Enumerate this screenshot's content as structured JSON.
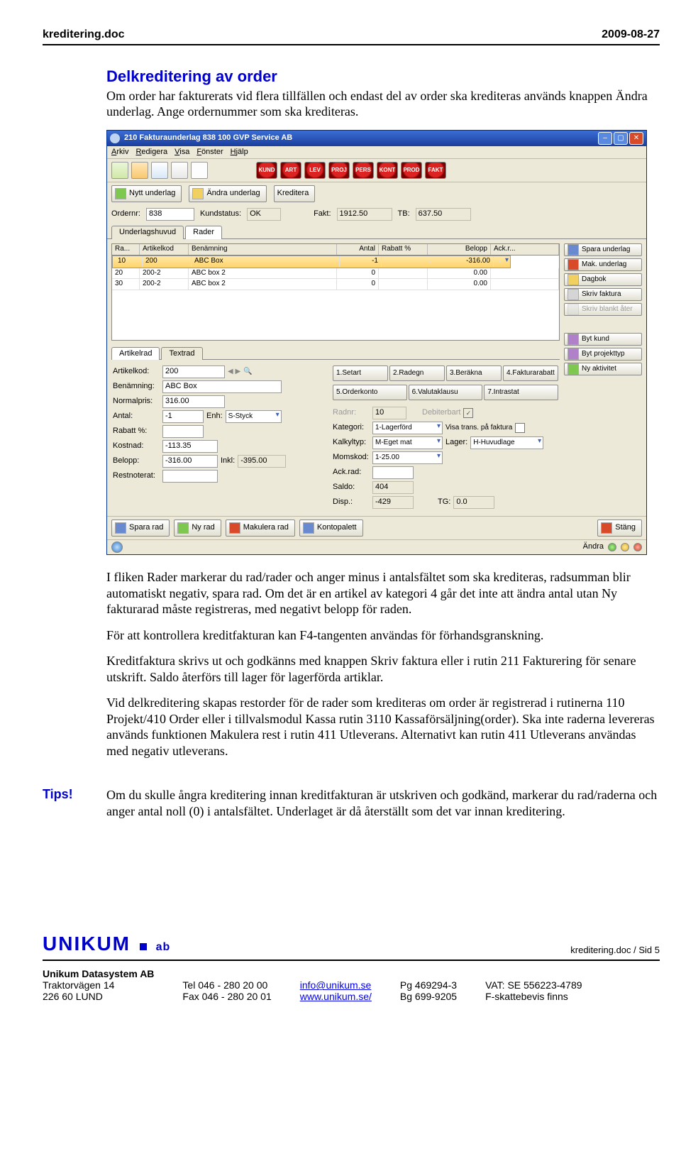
{
  "header": {
    "doc_name": "kreditering.doc",
    "date": "2009-08-27"
  },
  "section": {
    "title": "Delkreditering av order",
    "intro": "Om order har fakturerats vid flera tillfällen och endast del av order ska krediteras används knappen Ändra underlag. Ange ordernummer som ska krediteras."
  },
  "screenshot": {
    "title": "210 Fakturaunderlag 838  100  GVP Service AB",
    "menu": [
      "Arkiv",
      "Redigera",
      "Visa",
      "Fönster",
      "Hjälp"
    ],
    "red_btns": [
      "KUND",
      "ART",
      "LEV",
      "PROJ",
      "PERS",
      "KONT",
      "PROD",
      "FAKT"
    ],
    "btn_row": {
      "nytt": "Nytt underlag",
      "andra": "Ändra underlag",
      "kreditera": "Kreditera"
    },
    "order_row": {
      "ordernr_lbl": "Ordernr:",
      "ordernr_val": "838",
      "kundstatus_lbl": "Kundstatus:",
      "kundstatus_val": "OK",
      "fakt_lbl": "Fakt:",
      "fakt_val": "1912.50",
      "tb_lbl": "TB:",
      "tb_val": "637.50"
    },
    "tabs_main": [
      "Underlagshuvud",
      "Rader"
    ],
    "grid": {
      "headers": [
        "Ra...",
        "Artikelkod",
        "Benämning",
        "Antal",
        "Rabatt %",
        "Belopp",
        "Ack.r..."
      ],
      "rows": [
        [
          "10",
          "200",
          "ABC Box",
          "-1",
          "",
          "-316.00",
          ""
        ],
        [
          "20",
          "200-2",
          "ABC box 2",
          "0",
          "",
          "0.00",
          ""
        ],
        [
          "30",
          "200-2",
          "ABC box 2",
          "0",
          "",
          "0.00",
          ""
        ]
      ]
    },
    "right_btns": {
      "spara_underlag": "Spara underlag",
      "mak_underlag": "Mak. underlag",
      "dagbok": "Dagbok",
      "skriv_faktura": "Skriv faktura",
      "skriv_blankt": "Skriv blankt åter",
      "byt_kund": "Byt kund",
      "byt_projekttyp": "Byt projekttyp",
      "ny_aktivitet": "Ny aktivitet"
    },
    "sub_tabs": [
      "Artikelrad",
      "Textrad"
    ],
    "detail": {
      "artikelkod_lbl": "Artikelkod:",
      "artikelkod_val": "200",
      "benamning_lbl": "Benämning:",
      "benamning_val": "ABC Box",
      "normalpris_lbl": "Normalpris:",
      "normalpris_val": "316.00",
      "antal_lbl": "Antal:",
      "antal_val": "-1",
      "enh_lbl": "Enh:",
      "enh_val": "S-Styck",
      "rabatt_lbl": "Rabatt %:",
      "rabatt_val": "",
      "kostnad_lbl": "Kostnad:",
      "kostnad_val": "-113.35",
      "belopp_lbl": "Belopp:",
      "belopp_val": "-316.00",
      "inkl_lbl": "Inkl:",
      "inkl_val": "-395.00",
      "restnoterat_lbl": "Restnoterat:",
      "restnoterat_val": "",
      "radnr_lbl": "Radnr:",
      "radnr_val": "10",
      "debiterbart_lbl": "Debiterbart",
      "kategori_lbl": "Kategori:",
      "kategori_val": "1-Lagerförd",
      "visa_lbl": "Visa trans. på faktura",
      "kalkyltyp_lbl": "Kalkyltyp:",
      "kalkyltyp_val": "M-Eget mat",
      "lager_lbl": "Lager:",
      "lager_val": "H-Huvudlage",
      "momskod_lbl": "Momskod:",
      "momskod_val": "1-25.00",
      "ackrad_lbl": "Ack.rad:",
      "ackrad_val": "",
      "saldo_lbl": "Saldo:",
      "saldo_val": "404",
      "disp_lbl": "Disp.:",
      "disp_val": "-429",
      "tg_lbl": "TG:",
      "tg_val": "0.0"
    },
    "num_btns1": [
      "1.Setart",
      "2.Radegn",
      "3.Beräkna",
      "4.Fakturarabatt"
    ],
    "num_btns2": [
      "5.Orderkonto",
      "6.Valutaklausu",
      "7.Intrastat"
    ],
    "footer_btns": {
      "spara_rad": "Spara rad",
      "ny_rad": "Ny rad",
      "makulera_rad": "Makulera rad",
      "kontopalett": "Kontopalett",
      "stang": "Stäng"
    },
    "status_label": "Ändra"
  },
  "body_paras": [
    "I fliken Rader markerar du rad/rader och anger minus i antalsfältet som ska krediteras, radsumman blir automatiskt negativ, spara rad. Om det är en artikel av kategori 4 går det inte att ändra antal utan Ny fakturarad måste registreras, med negativt belopp för raden.",
    "För att kontrollera kreditfakturan kan F4-tangenten användas för förhandsgranskning.",
    "Kreditfaktura skrivs ut och godkänns med knappen Skriv faktura eller i rutin 211 Fakturering för senare utskrift. Saldo återförs till lager för lagerförda artiklar.",
    "Vid delkreditering skapas restorder för de rader som krediteras om order är registrerad i rutinerna 110 Projekt/410 Order eller i tillvalsmodul Kassa rutin 3110 Kassaförsäljning(order). Ska inte raderna levereras används funktionen Makulera rest i rutin 411 Utleverans. Alternativt kan rutin 411 Utleverans användas med negativ utleverans."
  ],
  "tips": {
    "label": "Tips!",
    "text": "Om du skulle ångra kreditering innan kreditfakturan är utskriven och godkänd, markerar du rad/raderna och anger antal noll (0) i antalsfältet. Underlaget är då återställt som det var innan kreditering."
  },
  "footer": {
    "logo_main": "UNIKUM",
    "logo_small": "ab",
    "page_ref": "kreditering.doc / Sid 5",
    "company": "Unikum Datasystem AB",
    "addr1": "Traktorvägen 14",
    "addr2": "226 60  LUND",
    "tel": "Tel  046 - 280 20 00",
    "fax": "Fax  046 - 280 20 01",
    "email": "info@unikum.se",
    "web": "www.unikum.se/",
    "pg": "Pg  469294-3",
    "bg": "Bg  699-9205",
    "vat": "VAT: SE 556223-4789",
    "fskatt": "F-skattebevis finns"
  }
}
